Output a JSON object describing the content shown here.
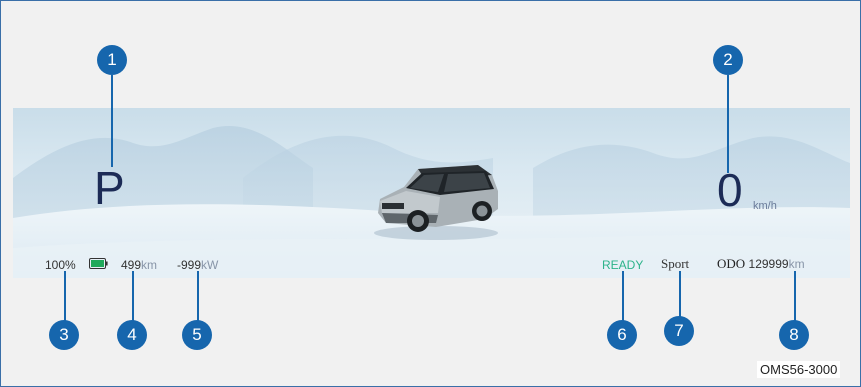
{
  "cluster": {
    "gear": "P",
    "speed": {
      "value": "0",
      "unit": "km/h"
    },
    "battery_percent": "100%",
    "battery_level": 1.0,
    "battery_color": "#1fa95a",
    "range": {
      "value": "499",
      "unit": "km"
    },
    "power": {
      "value": "-999",
      "unit": "kW"
    },
    "ready_text": "READY",
    "ready_color": "#2db38a",
    "drive_mode": "Sport",
    "odometer": {
      "label": "ODO",
      "value": "129999",
      "unit": "km"
    }
  },
  "callouts": [
    "1",
    "2",
    "3",
    "4",
    "5",
    "6",
    "7",
    "8"
  ],
  "figure_code": "OMS56-3000",
  "accent_color": "#1666ad",
  "icons": {
    "battery": "battery-full-icon",
    "vehicle": "suv-vehicle-icon"
  }
}
